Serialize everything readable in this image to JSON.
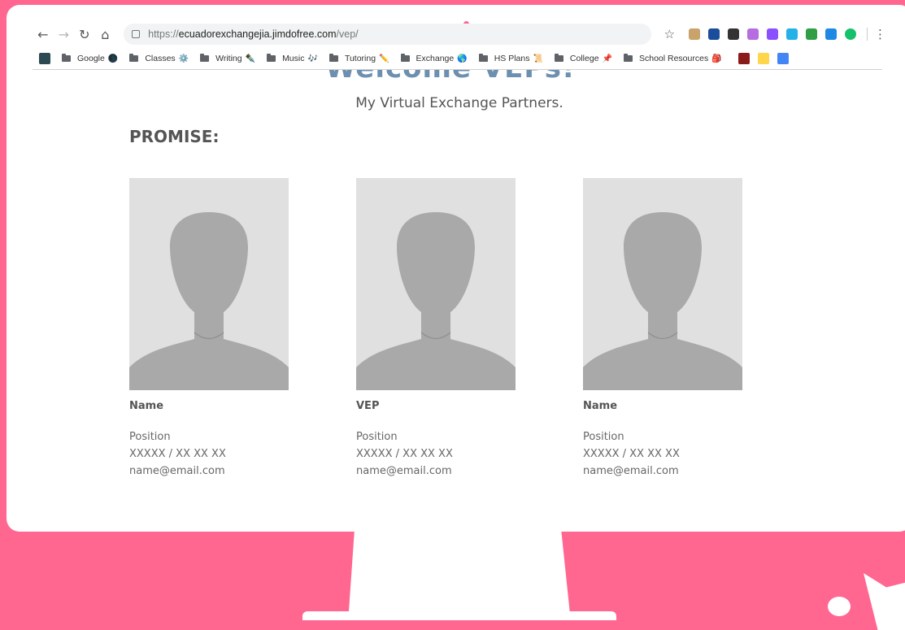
{
  "browser": {
    "url_scheme": "https://",
    "url_host": "ecuadorexchangejia.jimdofree.com",
    "url_path": "/vep/",
    "nav": {
      "back_icon": "←",
      "forward_icon": "→",
      "reload_icon": "↻",
      "home_icon": "⌂"
    },
    "star_icon": "☆",
    "menu_icon": "⋮",
    "extensions": [
      {
        "name": "ext-1-icon",
        "color": "#c9a36a"
      },
      {
        "name": "ext-2-icon",
        "color": "#1a4d9b"
      },
      {
        "name": "ext-3-icon",
        "color": "#333333"
      },
      {
        "name": "ext-4-icon",
        "color": "#b56de0"
      },
      {
        "name": "ext-5-icon",
        "color": "#8a4fff"
      },
      {
        "name": "ext-6-icon",
        "color": "#25b0e6"
      },
      {
        "name": "ext-7-icon",
        "color": "#2f9e44"
      },
      {
        "name": "ext-8-icon",
        "color": "#1e88e5"
      },
      {
        "name": "ext-9-icon",
        "color": "#15c26b"
      }
    ],
    "bookmarks": [
      {
        "label": "Google",
        "emoji": "🌑"
      },
      {
        "label": "Classes",
        "emoji": "⚙️"
      },
      {
        "label": "Writing",
        "emoji": "✒️"
      },
      {
        "label": "Music",
        "emoji": "🎶"
      },
      {
        "label": "Tutoring",
        "emoji": "✏️"
      },
      {
        "label": "Exchange",
        "emoji": "🌎"
      },
      {
        "label": "HS Plans",
        "emoji": "📜"
      },
      {
        "label": "College",
        "emoji": "📌"
      },
      {
        "label": "School Resources",
        "emoji": "🎒"
      }
    ]
  },
  "page": {
    "heading_partial": "Welcome VEPs!",
    "subtitle": "My Virtual Exchange Partners.",
    "section_title": "PROMISE:",
    "cards": [
      {
        "name": "Name",
        "position": "Position",
        "phone": "XXXXX / XX XX XX",
        "email": "name@email.com"
      },
      {
        "name": "VEP",
        "position": "Position",
        "phone": "XXXXX / XX XX XX",
        "email": "name@email.com"
      },
      {
        "name": "Name",
        "position": "Position",
        "phone": "XXXXX / XX XX XX",
        "email": "name@email.com"
      }
    ]
  },
  "colors": {
    "background": "#ff6690",
    "heading": "#6d8fb0",
    "placeholder_bg": "#e0e0e0",
    "silhouette": "#a9a9a9"
  }
}
